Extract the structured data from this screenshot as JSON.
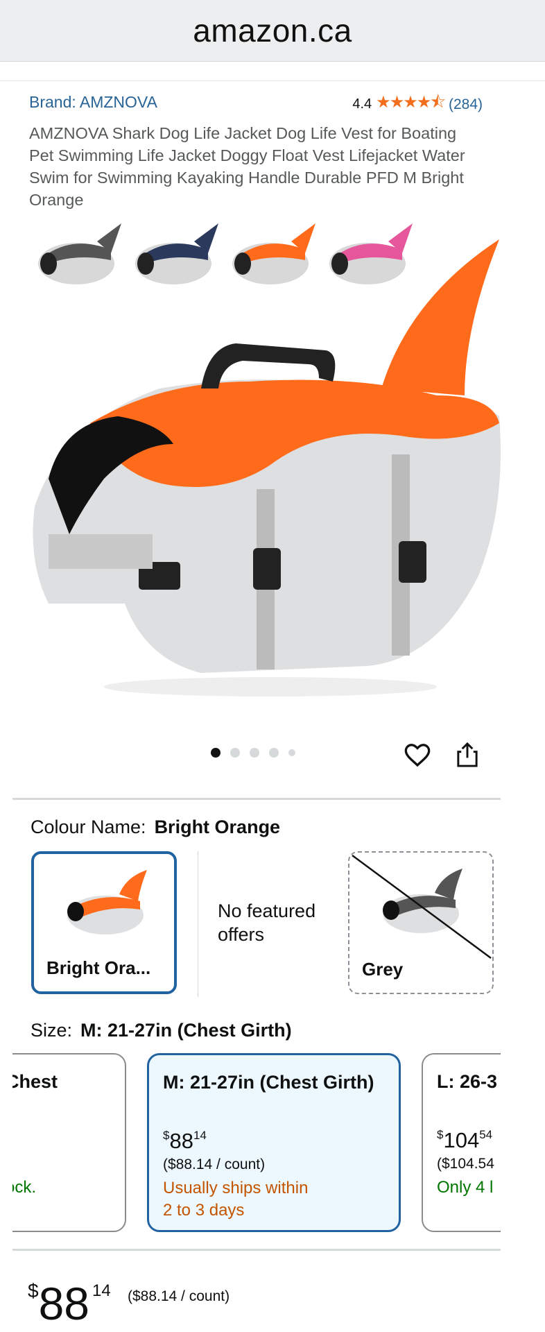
{
  "browser": {
    "domain": "amazon.ca"
  },
  "product": {
    "brand": "Brand: AMZNOVA",
    "rating": "4.4",
    "rating_stars": "★★★★⯪",
    "rating_count": "(284)",
    "title": "AMZNOVA Shark Dog Life Jacket Dog Life Vest for Boating Pet Swimming Life Jacket Doggy Float Vest Lifejacket Water Swim for Swimming Kayaking Handle Durable PFD M Bright Orange",
    "image_count": 5,
    "active_image": 1
  },
  "colour": {
    "label": "Colour Name:",
    "selected": "Bright Orange",
    "options": [
      {
        "label": "Bright Ora...",
        "state": "selected",
        "accent": "#FF6B1A"
      },
      {
        "label": "No featured offers"
      },
      {
        "label": "Grey",
        "state": "unavailable",
        "accent": "#555555"
      }
    ]
  },
  "size": {
    "label": "Size:",
    "selected": "M: 21-27in (Chest Girth)",
    "cards": [
      {
        "title": "Chest",
        "avail": "ock."
      },
      {
        "title": "M: 21-27in (Chest Girth)",
        "price_whole": "88",
        "price_cents": "14",
        "currency": "$",
        "unit": "($88.14 / count)",
        "avail_line1": "Usually ships within",
        "avail_line2": "2 to 3 days"
      },
      {
        "title": "L: 26-3",
        "price_whole": "104",
        "price_cents": "54",
        "currency": "$",
        "unit": "($104.54",
        "avail": "Only 4 l"
      }
    ]
  },
  "price": {
    "currency": "$",
    "whole": "88",
    "cents": "14",
    "per_unit": "($88.14 / count)"
  },
  "colors": {
    "link": "#2A6496",
    "selected_border": "#2162A1",
    "orange_text": "#C45500",
    "green_text": "#007600",
    "star": "#F26E1D"
  }
}
